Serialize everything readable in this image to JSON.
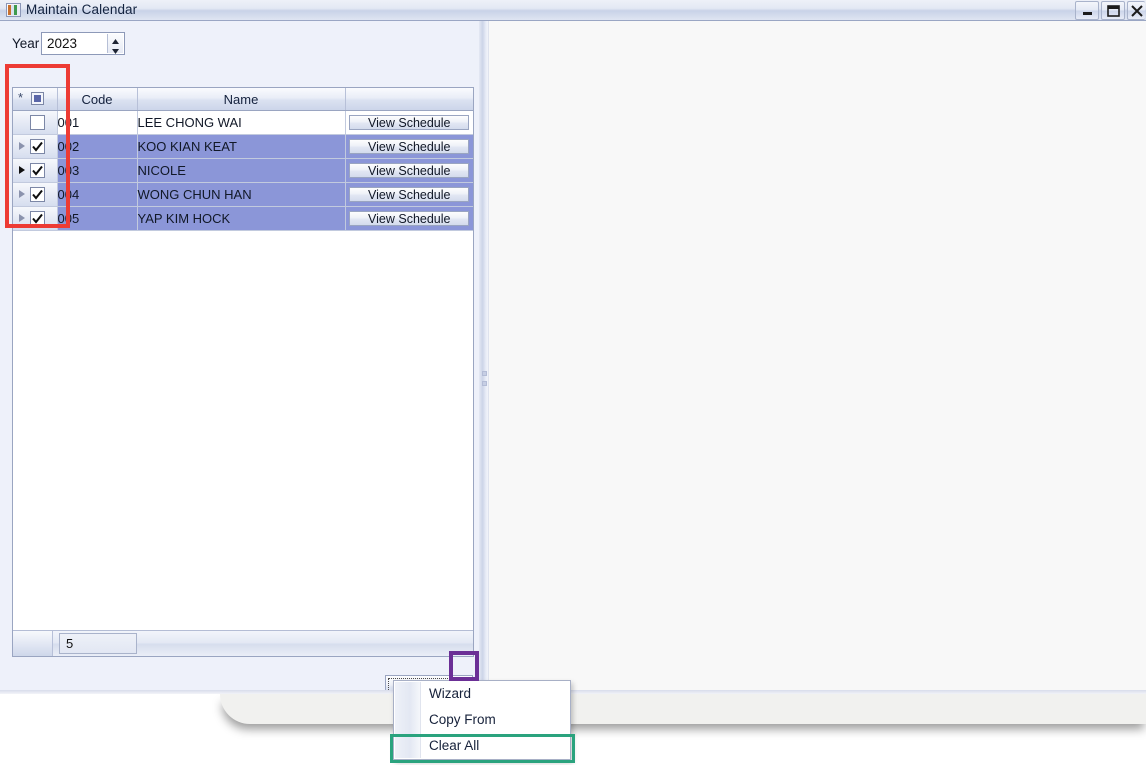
{
  "window": {
    "title": "Maintain Calendar",
    "icon": "calendar-app-icon",
    "controls": {
      "minimize": "minimize-icon",
      "maximize": "maximize-icon",
      "close": "close-icon"
    }
  },
  "toolbar": {
    "year_label": "Year",
    "year_value": "2023",
    "spinner_up": "spin-up-icon",
    "spinner_down": "spin-down-icon"
  },
  "grid": {
    "headers": {
      "select": "",
      "asterisk": "*",
      "select_all_state": "indeterminate",
      "code": "Code",
      "name": "Name",
      "action": ""
    },
    "rows": [
      {
        "code": "001",
        "name": "LEE CHONG WAI",
        "action_label": "View Schedule",
        "checked": false,
        "selected": false,
        "current": false
      },
      {
        "code": "002",
        "name": "KOO KIAN KEAT",
        "action_label": "View Schedule",
        "checked": true,
        "selected": true,
        "current": false
      },
      {
        "code": "003",
        "name": "NICOLE",
        "action_label": "View Schedule",
        "checked": true,
        "selected": true,
        "current": true
      },
      {
        "code": "004",
        "name": "WONG CHUN HAN",
        "action_label": "View Schedule",
        "checked": true,
        "selected": true,
        "current": false
      },
      {
        "code": "005",
        "name": "YAP KIM HOCK",
        "action_label": "View Schedule",
        "checked": true,
        "selected": true,
        "current": false
      }
    ],
    "footer": {
      "record_count": "5"
    }
  },
  "wizard": {
    "button_label": "Wizard",
    "dropdown_icon": "chevron-down-icon",
    "menu": [
      {
        "label": "Wizard"
      },
      {
        "label": "Copy From"
      },
      {
        "label": "Clear All"
      }
    ]
  },
  "annotations": {
    "red_box": "#ED3B34",
    "purple_box": "#6B2F96",
    "green_box": "#2AA37E"
  },
  "colors": {
    "selection_blue": "#8B96D8",
    "titlebar": "#E3E8F4",
    "panel_bg": "#EEF1FA",
    "right_panel_bg": "#F8F8F8"
  }
}
